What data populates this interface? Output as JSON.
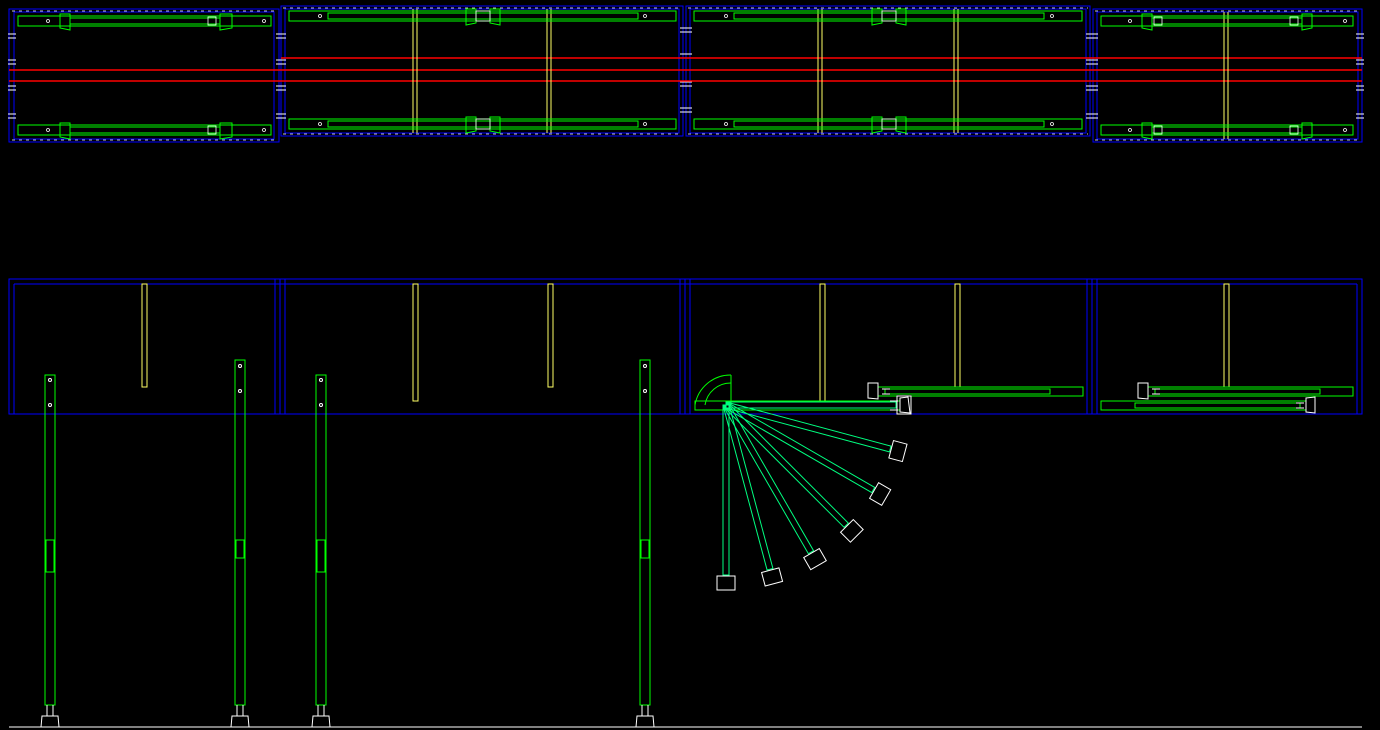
{
  "drawing": {
    "background": "#000000",
    "colors": {
      "frame": "#0000ff",
      "top_edge": "#ff00ff",
      "rail": "#ff0000",
      "part": "#00ff00",
      "swing": "#00ff80",
      "upright": "#ffff66",
      "detail": "#ffffff"
    },
    "swing_arm": {
      "angles_deg": [
        0,
        15,
        30,
        45,
        60,
        75,
        90
      ]
    }
  }
}
